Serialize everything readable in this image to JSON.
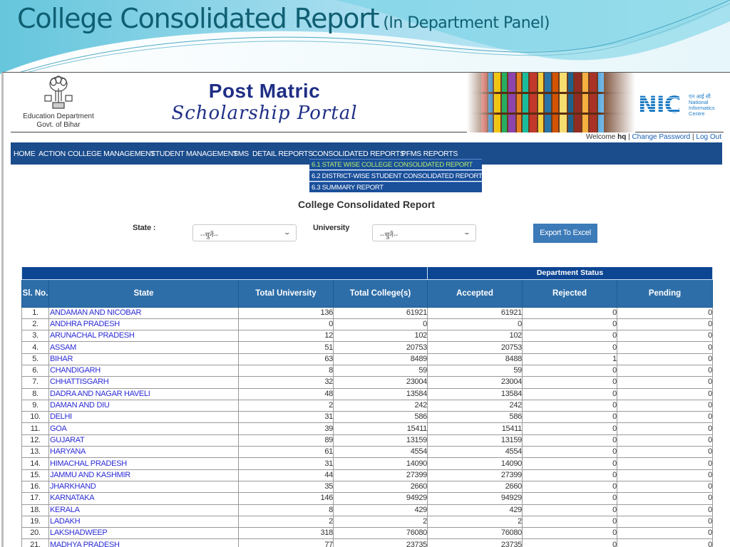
{
  "slide": {
    "title": "College Consolidated Report",
    "subtitle": "(In Department  Panel)"
  },
  "header": {
    "dept_line1": "Education Department",
    "dept_line2": "Govt. of Bihar",
    "portal_line1": "Post Matric",
    "portal_line2": "Scholarship Portal",
    "nic_mark": "NIC",
    "nic_hindi": "एन आई सी",
    "nic_line1": "National",
    "nic_line2": "Informatics",
    "nic_line3": "Centre"
  },
  "user_bar": {
    "welcome": "Welcome ",
    "username": "hq",
    "sep": " | ",
    "change_password": "Change Password",
    "logout": "Log Out"
  },
  "nav": {
    "items": [
      {
        "label": "HOME"
      },
      {
        "label": "ACTION"
      },
      {
        "label": "COLLEGE MANAGEMENT"
      },
      {
        "label": "STUDENT MANAGEMENT"
      },
      {
        "label": "SMS"
      },
      {
        "label": "DETAIL REPORTS"
      },
      {
        "label": "CONSOLIDATED REPORTS"
      },
      {
        "label": "PFMS REPORTS"
      }
    ],
    "dropdown": [
      {
        "label": "6.1 STATE WISE COLLEGE CONSOLIDATED REPORT"
      },
      {
        "label": "6.2 DISTRICT-WISE STUDENT CONSOLIDATED REPORT"
      },
      {
        "label": "6.3 SUMMARY REPORT"
      }
    ]
  },
  "report": {
    "title": "College Consolidated Report",
    "state_label": "State :",
    "state_value": "--चुनें--",
    "university_label": "University",
    "university_value": "--चुनें--",
    "export_label": "Export To Excel"
  },
  "table": {
    "group_header": "Department Status",
    "columns": [
      "Sl. No.",
      "State",
      "Total University",
      "Total College(s)",
      "Accepted",
      "Rejected",
      "Pending"
    ],
    "rows": [
      {
        "sl": "1.",
        "state": "ANDAMAN AND NICOBAR",
        "univ": "136",
        "colleges": "61921",
        "accepted": "61921",
        "rejected": "0",
        "pending": "0"
      },
      {
        "sl": "2.",
        "state": "ANDHRA PRADESH",
        "univ": "0",
        "colleges": "0",
        "accepted": "0",
        "rejected": "0",
        "pending": "0"
      },
      {
        "sl": "3.",
        "state": "ARUNACHAL PRADESH",
        "univ": "12",
        "colleges": "102",
        "accepted": "102",
        "rejected": "0",
        "pending": "0"
      },
      {
        "sl": "4.",
        "state": "ASSAM",
        "univ": "51",
        "colleges": "20753",
        "accepted": "20753",
        "rejected": "0",
        "pending": "0"
      },
      {
        "sl": "5.",
        "state": "BIHAR",
        "univ": "63",
        "colleges": "8489",
        "accepted": "8488",
        "rejected": "1",
        "pending": "0"
      },
      {
        "sl": "6.",
        "state": "CHANDIGARH",
        "univ": "8",
        "colleges": "59",
        "accepted": "59",
        "rejected": "0",
        "pending": "0"
      },
      {
        "sl": "7.",
        "state": "CHHATTISGARH",
        "univ": "32",
        "colleges": "23004",
        "accepted": "23004",
        "rejected": "0",
        "pending": "0"
      },
      {
        "sl": "8.",
        "state": "DADRA AND NAGAR HAVELI",
        "univ": "48",
        "colleges": "13584",
        "accepted": "13584",
        "rejected": "0",
        "pending": "0"
      },
      {
        "sl": "9.",
        "state": "DAMAN AND DIU",
        "univ": "2",
        "colleges": "242",
        "accepted": "242",
        "rejected": "0",
        "pending": "0"
      },
      {
        "sl": "10.",
        "state": "DELHI",
        "univ": "31",
        "colleges": "586",
        "accepted": "586",
        "rejected": "0",
        "pending": "0"
      },
      {
        "sl": "11.",
        "state": "GOA",
        "univ": "39",
        "colleges": "15411",
        "accepted": "15411",
        "rejected": "0",
        "pending": "0"
      },
      {
        "sl": "12.",
        "state": "GUJARAT",
        "univ": "89",
        "colleges": "13159",
        "accepted": "13159",
        "rejected": "0",
        "pending": "0"
      },
      {
        "sl": "13.",
        "state": "HARYANA",
        "univ": "61",
        "colleges": "4554",
        "accepted": "4554",
        "rejected": "0",
        "pending": "0"
      },
      {
        "sl": "14.",
        "state": "HIMACHAL PRADESH",
        "univ": "31",
        "colleges": "14090",
        "accepted": "14090",
        "rejected": "0",
        "pending": "0"
      },
      {
        "sl": "15.",
        "state": "JAMMU AND KASHMIR",
        "univ": "44",
        "colleges": "27399",
        "accepted": "27399",
        "rejected": "0",
        "pending": "0"
      },
      {
        "sl": "16.",
        "state": "JHARKHAND",
        "univ": "35",
        "colleges": "2660",
        "accepted": "2660",
        "rejected": "0",
        "pending": "0"
      },
      {
        "sl": "17.",
        "state": "KARNATAKA",
        "univ": "146",
        "colleges": "94929",
        "accepted": "94929",
        "rejected": "0",
        "pending": "0"
      },
      {
        "sl": "18.",
        "state": "KERALA",
        "univ": "8",
        "colleges": "429",
        "accepted": "429",
        "rejected": "0",
        "pending": "0"
      },
      {
        "sl": "19.",
        "state": "LADAKH",
        "univ": "2",
        "colleges": "2",
        "accepted": "2",
        "rejected": "0",
        "pending": "0"
      },
      {
        "sl": "20.",
        "state": "LAKSHADWEEP",
        "univ": "318",
        "colleges": "76080",
        "accepted": "76080",
        "rejected": "0",
        "pending": "0"
      },
      {
        "sl": "21.",
        "state": "MADHYA PRADESH",
        "univ": "77",
        "colleges": "23735",
        "accepted": "23735",
        "rejected": "0",
        "pending": "0"
      }
    ]
  },
  "colors": {
    "nav_bg": "#1b4c8c",
    "table_header": "#2e6ea8",
    "group_header": "#0c4592",
    "link": "#2b2bd6",
    "highlight_menu": "#b5ec6c",
    "slide_title": "#0f5f73"
  }
}
